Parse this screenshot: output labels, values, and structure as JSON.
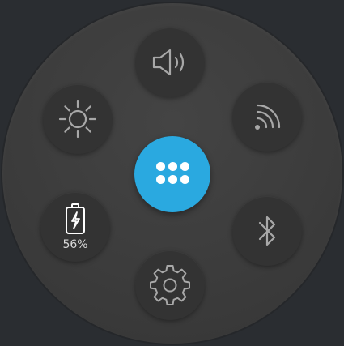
{
  "quick_settings": {
    "tiles": {
      "volume": {
        "icon": "volume-icon"
      },
      "brightness": {
        "icon": "brightness-icon"
      },
      "wifi": {
        "icon": "wifi-icon"
      },
      "battery": {
        "icon": "battery-charging-icon",
        "level_label": "56%",
        "level_percent": 56
      },
      "bluetooth": {
        "icon": "bluetooth-icon"
      },
      "settings": {
        "icon": "gear-icon"
      }
    },
    "center_button": {
      "icon": "apps-grid-icon"
    }
  },
  "colors": {
    "accent": "#2aa9e0",
    "background": "#2a2d31",
    "face": "#3c3c3c",
    "tile": "#333333",
    "icon": "#a8a8a8",
    "battery_text": "#d9d9d9"
  }
}
